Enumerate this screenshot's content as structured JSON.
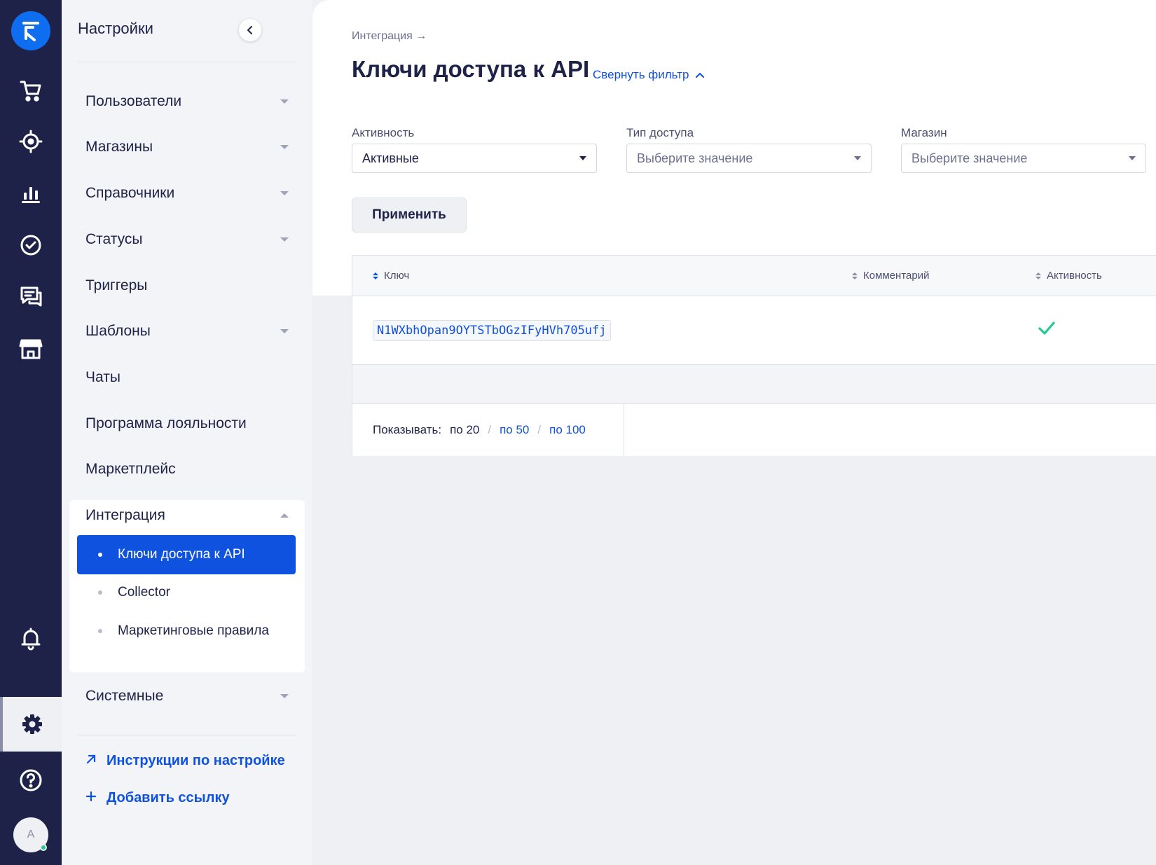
{
  "app": {
    "avatar_letter": "A",
    "accent": "#0f52e0",
    "rail_bg": "#1e2248",
    "success": "#22c993"
  },
  "rail": {
    "icons": [
      "logo-icon",
      "cart-icon",
      "target-icon",
      "analytics-icon",
      "tasks-icon",
      "chat-icon",
      "store-icon",
      "bell-icon",
      "gear-icon",
      "help-icon"
    ],
    "active": "gear-icon"
  },
  "sidebar": {
    "title": "Настройки",
    "items": [
      {
        "label": "Пользователи",
        "expandable": true
      },
      {
        "label": "Магазины",
        "expandable": true
      },
      {
        "label": "Справочники",
        "expandable": true
      },
      {
        "label": "Статусы",
        "expandable": true
      },
      {
        "label": "Триггеры",
        "expandable": false
      },
      {
        "label": "Шаблоны",
        "expandable": true
      },
      {
        "label": "Чаты",
        "expandable": false
      },
      {
        "label": "Программа лояльности",
        "expandable": false
      },
      {
        "label": "Маркетплейс",
        "expandable": false
      },
      {
        "label": "Интеграция",
        "expandable": true,
        "expanded": true
      },
      {
        "label": "Системные",
        "expandable": true
      }
    ],
    "integration_sub": [
      {
        "label": "Ключи доступа к API",
        "active": true
      },
      {
        "label": "Collector",
        "active": false
      },
      {
        "label": "Маркетинговые правила",
        "active": false
      }
    ],
    "links": [
      {
        "icon": "arrow-up-right-icon",
        "label": "Инструкции по настройке"
      },
      {
        "icon": "plus-icon",
        "label": "Добавить ссылку"
      }
    ]
  },
  "main": {
    "breadcrumb": "Интеграция →",
    "title": "Ключи доступа к API",
    "toggle_filter": "Свернуть фильтр",
    "filters": [
      {
        "label": "Активность",
        "value": "Активные",
        "placeholder": ""
      },
      {
        "label": "Тип доступа",
        "value": "",
        "placeholder": "Выберите значение"
      },
      {
        "label": "Магазин",
        "value": "",
        "placeholder": "Выберите значение"
      }
    ],
    "apply": "Применить",
    "table": {
      "columns": [
        "Ключ",
        "Комментарий",
        "Активность"
      ],
      "rows": [
        {
          "key": "N1WXbhOpan9OYTSTbOGzIFyHVh705ufj",
          "comment": "",
          "active": true
        }
      ],
      "pager": {
        "label": "Показывать:",
        "options": [
          "по 20",
          "по 50",
          "по 100"
        ],
        "current": "по 20"
      }
    }
  }
}
